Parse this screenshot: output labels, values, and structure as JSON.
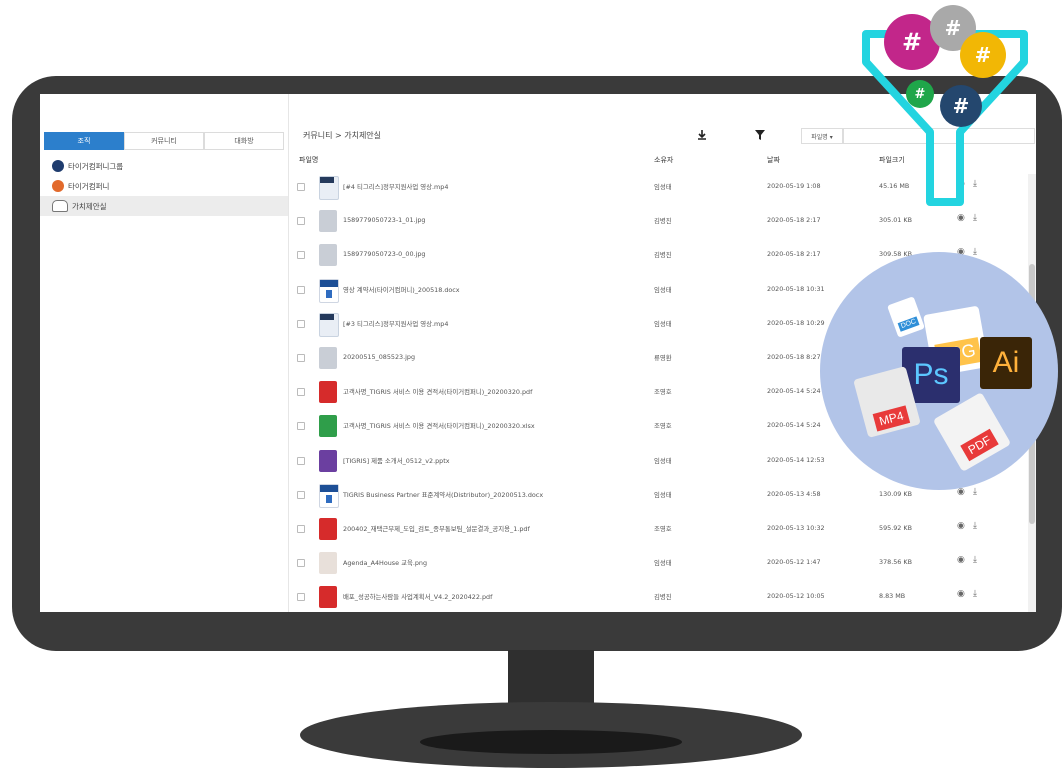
{
  "tabs": [
    {
      "label": "조직",
      "active": true
    },
    {
      "label": "커뮤니티",
      "active": false
    },
    {
      "label": "대화방",
      "active": false
    }
  ],
  "tree": [
    {
      "label": "타이거컴퍼니그룹",
      "icon": "company-group-icon"
    },
    {
      "label": "타이거컴퍼니",
      "icon": "company-icon"
    },
    {
      "label": "가치제안실",
      "icon": "community-group-icon",
      "selected": true
    }
  ],
  "breadcrumb": "커뮤니티 > 가치제안실",
  "toolbar": {
    "download_icon": "download-icon",
    "filter_icon": "filter-icon",
    "sort_label": "파일명 ▾"
  },
  "table": {
    "headers": [
      "파일명",
      "소유자",
      "날짜",
      "파일크기"
    ],
    "rows": [
      {
        "type": "video",
        "name": "[#4 티그리스]정부지원사업 영상.mp4",
        "owner": "임성태",
        "date": "2020-05-19 1:08",
        "size": "45.16 MB"
      },
      {
        "type": "img",
        "name": "1589779050723-1_01.jpg",
        "owner": "김병진",
        "date": "2020-05-18 2:17",
        "size": "305.01 KB"
      },
      {
        "type": "img",
        "name": "1589779050723-0_00.jpg",
        "owner": "김병진",
        "date": "2020-05-18 2:17",
        "size": "309.58 KB"
      },
      {
        "type": "doc",
        "name": "영상 계약서(타이거컴퍼니)_200518.docx",
        "owner": "임성태",
        "date": "2020-05-18 10:31",
        "size": ""
      },
      {
        "type": "video",
        "name": "[#3 티그리스]정부지원사업 영상.mp4",
        "owner": "임성태",
        "date": "2020-05-18 10:29",
        "size": ""
      },
      {
        "type": "img",
        "name": "20200515_085523.jpg",
        "owner": "류영환",
        "date": "2020-05-18 8:27",
        "size": ""
      },
      {
        "type": "pdf",
        "name": "고객사명_TIGRIS 서비스 이용 견적서(타이거컴퍼니)_20200320.pdf",
        "owner": "조영호",
        "date": "2020-05-14 5:24",
        "size": ""
      },
      {
        "type": "xls",
        "name": "고객사명_TIGRIS 서비스 이용 견적서(타이거컴퍼니)_20200320.xlsx",
        "owner": "조영호",
        "date": "2020-05-14 5:24",
        "size": ""
      },
      {
        "type": "ppt",
        "name": "[TIGRIS] 제품 소개서_0512_v2.pptx",
        "owner": "임성태",
        "date": "2020-05-14 12:53",
        "size": ""
      },
      {
        "type": "doc",
        "name": "TIGRIS Business Partner 표준계약서(Distributor)_20200513.docx",
        "owner": "임성태",
        "date": "2020-05-13 4:58",
        "size": "130.09 KB"
      },
      {
        "type": "pdf",
        "name": "200402_재택근무제_도입_검토_종무통보팀_설문결과_공지용_1.pdf",
        "owner": "조영호",
        "date": "2020-05-13 10:32",
        "size": "595.92 KB"
      },
      {
        "type": "png",
        "name": "Agenda_A4House 교육.png",
        "owner": "임성태",
        "date": "2020-05-12 1:47",
        "size": "378.56 KB"
      },
      {
        "type": "pdf",
        "name": "배포_성공하는사람들 사업계획서_V4.2_2020422.pdf",
        "owner": "김병진",
        "date": "2020-05-12 10:05",
        "size": "8.83 MB"
      }
    ]
  },
  "decor": {
    "hashtag": "#",
    "colors": {
      "magenta": "#c2268a",
      "gray": "#a9a9a9",
      "yellow": "#f2b705",
      "green": "#1fa64a",
      "navy": "#24476e",
      "funnel": "#23d4e0"
    },
    "file_types": [
      "DOC",
      "JPG",
      "Ps",
      "Ai",
      "MP4",
      "PDF"
    ]
  }
}
